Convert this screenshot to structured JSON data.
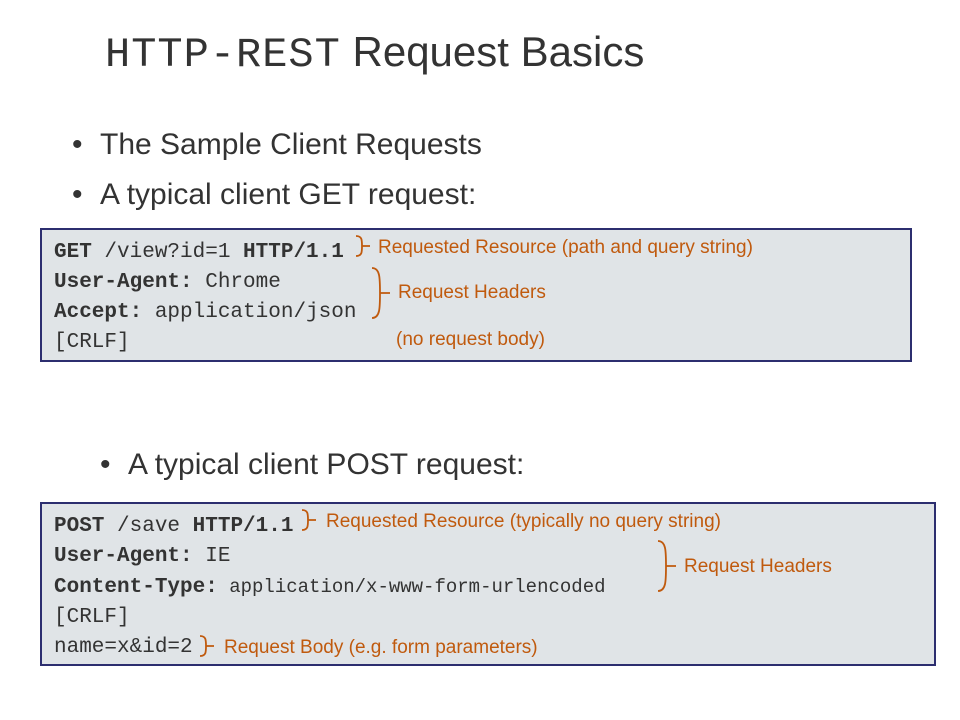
{
  "title": {
    "mono": "HTTP-REST",
    "rest": " Request Basics"
  },
  "bullets": {
    "b1": "The Sample Client Requests",
    "b2": "A typical client GET request:",
    "b3": "A typical client POST request:"
  },
  "get_box": {
    "l1_pre": "GET",
    "l1_mid": " /view?id=1",
    "l1_suf": " HTTP/1.1",
    "l2_pre": "User-Agent:",
    "l2_val": " Chrome",
    "l3_pre": "Accept:",
    "l3_val": " application/json",
    "l4": "[CRLF]"
  },
  "post_box": {
    "l1_pre": "POST",
    "l1_mid": " /save",
    "l1_suf": " HTTP/1.1",
    "l2_pre": "User-Agent:",
    "l2_val": " IE",
    "l3_pre": "Content-Type:",
    "l3_val": " application/x-www-form-urlencoded",
    "l4": "[CRLF]",
    "l5": "name=x&id=2"
  },
  "annotations": {
    "get_resource": "Requested Resource (path and query string)",
    "get_headers": "Request Headers",
    "get_nobody": "(no request body)",
    "post_resource": "Requested Resource (typically no query string)",
    "post_headers": "Request Headers",
    "post_body": "Request Body (e.g. form parameters)"
  }
}
